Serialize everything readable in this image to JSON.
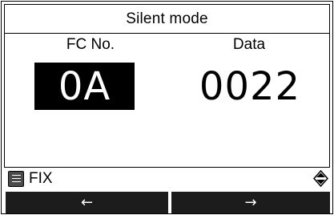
{
  "title": "Silent mode",
  "fc": {
    "label": "FC No.",
    "value": "0A"
  },
  "data": {
    "label": "Data",
    "value": "0022"
  },
  "status": {
    "mode_text": "FIX",
    "menu_icon": "list-menu-icon",
    "scroll_icon": "up-down-arrow-icon"
  },
  "nav": {
    "left": "←",
    "right": "→"
  }
}
